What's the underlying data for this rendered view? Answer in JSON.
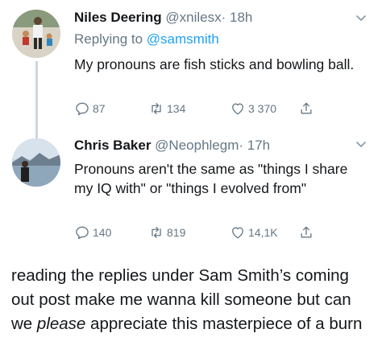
{
  "tweets": [
    {
      "name": "Niles Deering",
      "handle": "@xnilesx",
      "time": "· 18h",
      "replying_to_label": "Replying to",
      "replying_to_handle": "@samsmith",
      "text": "My pronouns are fish sticks and bowling ball.",
      "stats": {
        "replies": "87",
        "retweets": "134",
        "likes": "3 370"
      }
    },
    {
      "name": "Chris Baker",
      "handle": "@Neophlegm",
      "time": "· 17h",
      "text": "Pronouns aren't the same as \"things I share my IQ with\" or \"things I evolved from\"",
      "stats": {
        "replies": "140",
        "retweets": "819",
        "likes": "14,1K"
      }
    }
  ],
  "caption": {
    "before": "reading the replies under Sam Smith’s coming out post make me wanna kill someone but can we",
    "emphasis": "please",
    "after": "appreciate this masterpiece of a burn"
  },
  "icons": {
    "reply": "reply-icon",
    "retweet": "retweet-icon",
    "like": "heart-icon",
    "share": "share-icon",
    "caret": "chevron-down-icon"
  },
  "colors": {
    "text": "#14171a",
    "muted": "#657786",
    "link": "#1da1f2",
    "thread": "#ccd6dd"
  }
}
